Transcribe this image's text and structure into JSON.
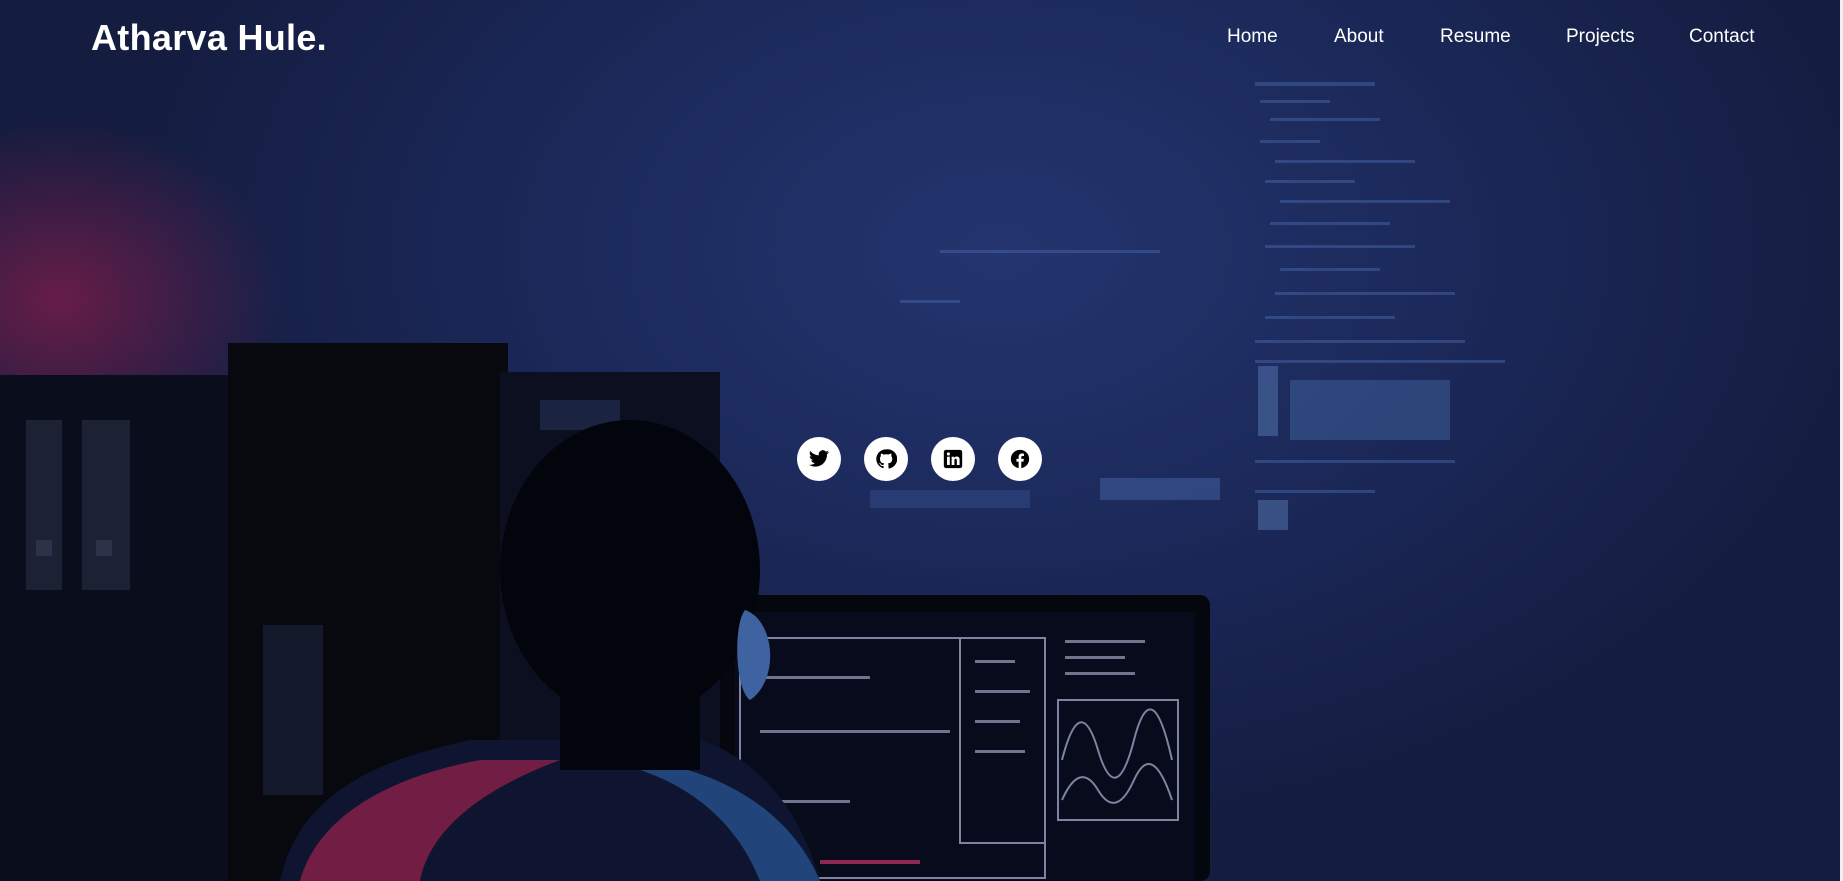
{
  "brand": {
    "name": "Atharva Hule."
  },
  "nav": {
    "items": [
      {
        "label": "Home"
      },
      {
        "label": "About"
      },
      {
        "label": "Resume"
      },
      {
        "label": "Projects"
      },
      {
        "label": "Contact"
      }
    ]
  },
  "social": [
    {
      "icon": "twitter-icon"
    },
    {
      "icon": "github-icon"
    },
    {
      "icon": "linkedin-icon"
    },
    {
      "icon": "facebook-icon"
    }
  ],
  "colors": {
    "hero_background": "#1c2a5c",
    "accent_glow": "#aa1e50",
    "text": "#ffffff"
  }
}
